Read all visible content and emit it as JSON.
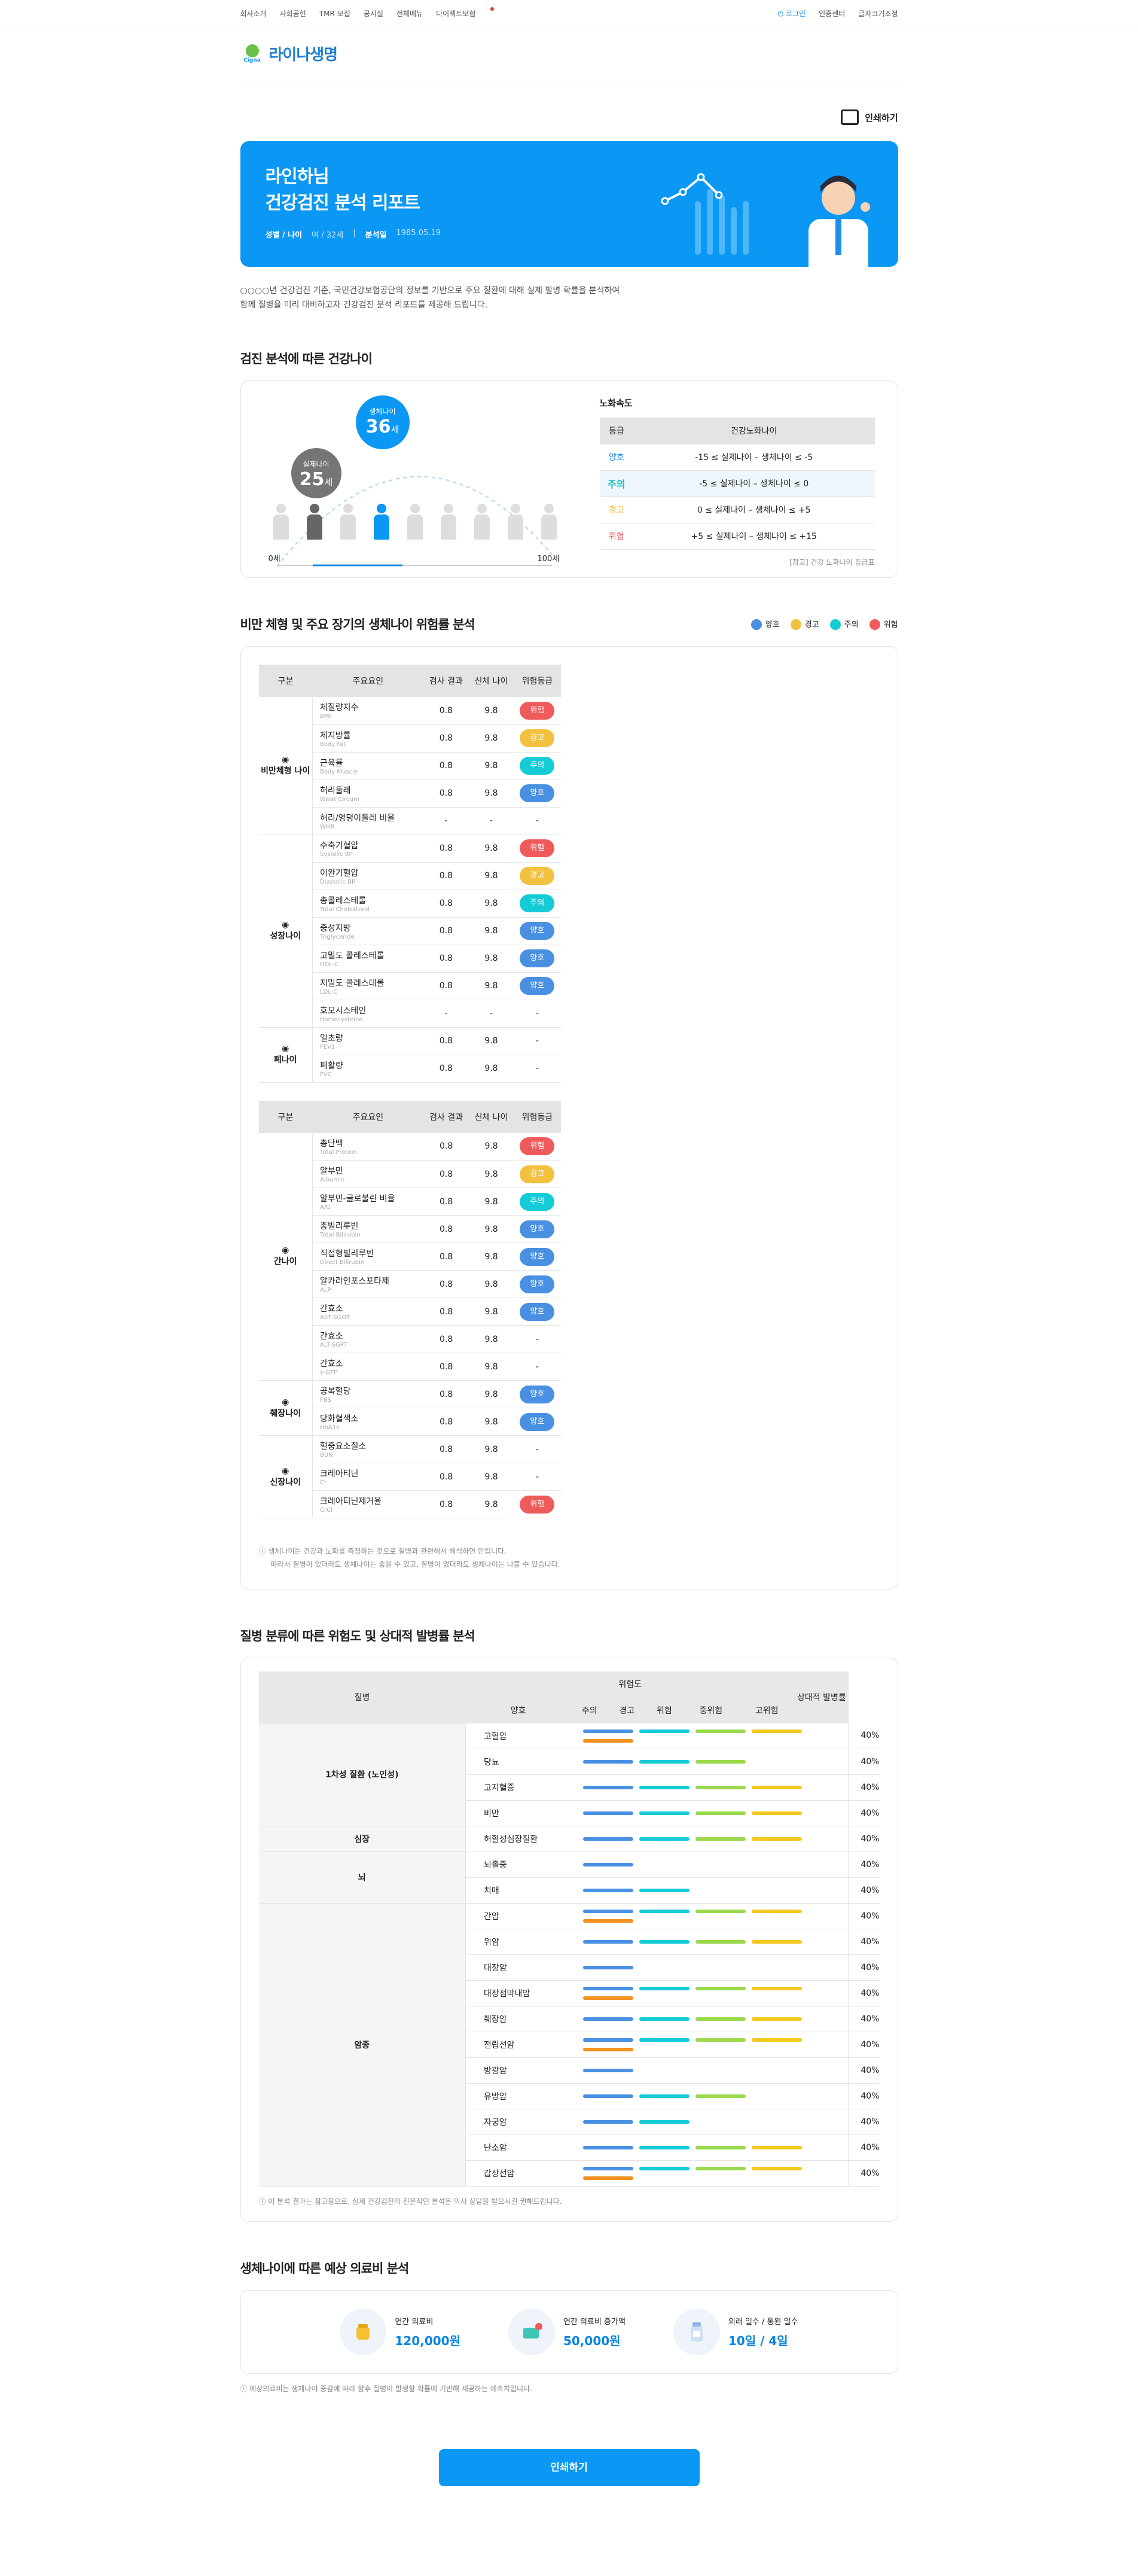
{
  "topnav": {
    "links": [
      "회사소개",
      "사회공헌",
      "TMR 모집",
      "공시실",
      "전체메뉴",
      "다이렉트보험"
    ],
    "login": "로그인",
    "cert": "인증센터",
    "font": "글자크기조정"
  },
  "logo": {
    "brand": "Cigna",
    "name": "라이나생명"
  },
  "print_label": "인쇄하기",
  "hero": {
    "user": "라인하님",
    "title": "건강검진 분석 리포트",
    "gender_label": "성별 / 나이",
    "gender_value": "여 / 32세",
    "date_label": "분석일",
    "date_value": "1985.05.19"
  },
  "intro": [
    "○○○○년 건강검진 기준, 국민건강보험공단의 정보를 기반으로 주요 질환에 대해 실제 발병 확률을 분석하여",
    "함께 질병을 미리 대비하고자 건강검진 분석 리포트를 제공해 드립니다."
  ],
  "sec1": {
    "title": "검진 분석에 따른 건강나이",
    "real_label": "실제나이",
    "real_value": "25",
    "body_label": "생체나이",
    "body_value": "36",
    "unit": "세",
    "min": "0세",
    "max": "100세",
    "table_title": "노화속도",
    "col1": "등급",
    "col2": "건강노화나이",
    "rows": [
      {
        "grade": "양호",
        "range": "-15 ≤ 실제나이 – 생체나이 ≤ -5",
        "color": "#1b8fe9"
      },
      {
        "grade": "주의",
        "range": "-5 ≤ 실제나이 – 생체나이 ≤ 0",
        "color": "#14c4c8"
      },
      {
        "grade": "경고",
        "range": "0 ≤ 실제나이 – 생체나이 ≤ +5",
        "color": "#f0b92f"
      },
      {
        "grade": "위험",
        "range": "+5 ≤ 실제나이 – 생체나이 ≤ +15",
        "color": "#ef5b5b"
      }
    ],
    "table_note": "[참고] 건강 노화나이 등급표"
  },
  "sec2": {
    "title": "비만 체형 및 주요 장기의 생체나이 위험률 분석",
    "legend": [
      {
        "label": "양호",
        "color": "#4a90e2"
      },
      {
        "label": "경고",
        "color": "#f2c140"
      },
      {
        "label": "주의",
        "color": "#15cbd6"
      },
      {
        "label": "위험",
        "color": "#ef5b5b"
      }
    ],
    "headers": [
      "구분",
      "주요요인",
      "검사 결과",
      "신체 나이",
      "위험등급"
    ],
    "left": [
      {
        "cat": "비만체형 나이",
        "items": [
          [
            "체질량지수",
            "BMI",
            "0.8",
            "9.8",
            "위험"
          ],
          [
            "체지방률",
            "Body Fat",
            "0.8",
            "9.8",
            "경고"
          ],
          [
            "근육률",
            "Body Muscle",
            "0.8",
            "9.8",
            "주의"
          ],
          [
            "허리둘레",
            "Waist Circum",
            "0.8",
            "9.8",
            "양호"
          ],
          [
            "허리/엉덩이둘레 비율",
            "WHR",
            "-",
            "-",
            "-"
          ]
        ]
      },
      {
        "cat": "성장나이",
        "items": [
          [
            "수축기혈압",
            "Systolic BP",
            "0.8",
            "9.8",
            "위험"
          ],
          [
            "이완기혈압",
            "Diastolic BP",
            "0.8",
            "9.8",
            "경고"
          ],
          [
            "총콜레스테롤",
            "Total Cholesterol",
            "0.8",
            "9.8",
            "주의"
          ],
          [
            "중성지방",
            "Triglyceride",
            "0.8",
            "9.8",
            "양호"
          ],
          [
            "고밀도 콜레스테롤",
            "HDL-C",
            "0.8",
            "9.8",
            "양호"
          ],
          [
            "저밀도 콜레스테롤",
            "LDL-C",
            "0.8",
            "9.8",
            "양호"
          ],
          [
            "호모시스테인",
            "Homocysteine",
            "-",
            "-",
            "-"
          ]
        ]
      },
      {
        "cat": "폐나이",
        "items": [
          [
            "일초량",
            "FEV1",
            "0.8",
            "9.8",
            "-"
          ],
          [
            "폐활량",
            "FVC",
            "0.8",
            "9.8",
            "-"
          ]
        ]
      }
    ],
    "right": [
      {
        "cat": "간나이",
        "items": [
          [
            "총단백",
            "Total Protein",
            "0.8",
            "9.8",
            "위험"
          ],
          [
            "알부민",
            "Albumin",
            "0.8",
            "9.8",
            "경고"
          ],
          [
            "알부민-글로불린 비율",
            "A/G",
            "0.8",
            "9.8",
            "주의"
          ],
          [
            "총빌리루빈",
            "Total Bilirubin",
            "0.8",
            "9.8",
            "양호"
          ],
          [
            "직접형빌리루빈",
            "Direct Bilirubin",
            "0.8",
            "9.8",
            "양호"
          ],
          [
            "알카라인포스포타제",
            "ALP",
            "0.8",
            "9.8",
            "양호"
          ],
          [
            "간효소",
            "AST-SGOT",
            "0.8",
            "9.8",
            "양호"
          ],
          [
            "간효소",
            "ALT-SGPT",
            "0.8",
            "9.8",
            "-"
          ],
          [
            "간효소",
            "γ-GTP",
            "0.8",
            "9.8",
            "-"
          ]
        ]
      },
      {
        "cat": "췌장나이",
        "items": [
          [
            "공복혈당",
            "FBS",
            "0.8",
            "9.8",
            "양호"
          ],
          [
            "당화혈색소",
            "HbA1c",
            "0.8",
            "9.8",
            "양호"
          ]
        ]
      },
      {
        "cat": "신장나이",
        "items": [
          [
            "혈중요소질소",
            "BUN",
            "0.8",
            "9.8",
            "-"
          ],
          [
            "크레아티닌",
            "Cr",
            "0.8",
            "9.8",
            "-"
          ],
          [
            "크레아티닌제거율",
            "CrCl",
            "0.8",
            "9.8",
            "위험"
          ]
        ]
      }
    ],
    "note": [
      "생체나이는 건강과 노화를 측정하는 것으로 질병과 관련해서 해석하면 안됩니다.",
      "따라서 질병이 있더라도 생체나이는 좋을 수 있고, 질병이 없더라도 생체나이는 나쁠 수 있습니다."
    ]
  },
  "sec3": {
    "title": "질병 분류에 따른 위험도 및 상대적 발병률 분석",
    "col_disease": "질병",
    "col_risk": "위험도",
    "col_rate": "상대적 발병률",
    "levels": [
      "양호",
      "주의",
      "경고",
      "위험",
      "중위험",
      "고위험"
    ],
    "groups": [
      {
        "group": "1차성 질환 (노인성)",
        "rows": [
          [
            "고혈압",
            5
          ],
          [
            "당뇨",
            3
          ],
          [
            "고지혈증",
            4
          ],
          [
            "비만",
            4
          ]
        ]
      },
      {
        "group": "심장",
        "rows": [
          [
            "허혈성심장질환",
            4
          ]
        ]
      },
      {
        "group": "뇌",
        "rows": [
          [
            "뇌졸중",
            1
          ],
          [
            "치매",
            2
          ]
        ]
      },
      {
        "group": "암종",
        "rows": [
          [
            "간암",
            5
          ],
          [
            "위암",
            4
          ],
          [
            "대장암",
            1
          ],
          [
            "대장점막내암",
            5
          ],
          [
            "췌장암",
            4
          ],
          [
            "전립선암",
            5
          ],
          [
            "방광암",
            1
          ],
          [
            "유방암",
            3
          ],
          [
            "자궁암",
            2
          ],
          [
            "난소암",
            4
          ],
          [
            "갑상선암",
            5
          ]
        ]
      }
    ],
    "rate": "40%",
    "note": "이 분석 결과는 참고용으로, 실제 건강검진의 전문적인 분석은 의사 상담을 받으시길 권해드립니다."
  },
  "sec4": {
    "title": "생체나이에 따른 예상 의료비 분석",
    "items": [
      {
        "label": "연간 의료비",
        "value": "120,000원"
      },
      {
        "label": "연간 의료비 증가액",
        "value": "50,000원"
      },
      {
        "label": "외래 일수 / 통원 일수",
        "value": "10일 / 4일"
      }
    ],
    "note": "예상의료비는 생체나이 증감에 따라 향후 질병이 발생할 확률에 기반해 제공하는 예측치입니다."
  },
  "colors": {
    "primary": "#0b97f4",
    "good": "#4a90e2",
    "caution": "#15cbd6",
    "warn": "#f2c140",
    "danger": "#ef5b5b"
  }
}
